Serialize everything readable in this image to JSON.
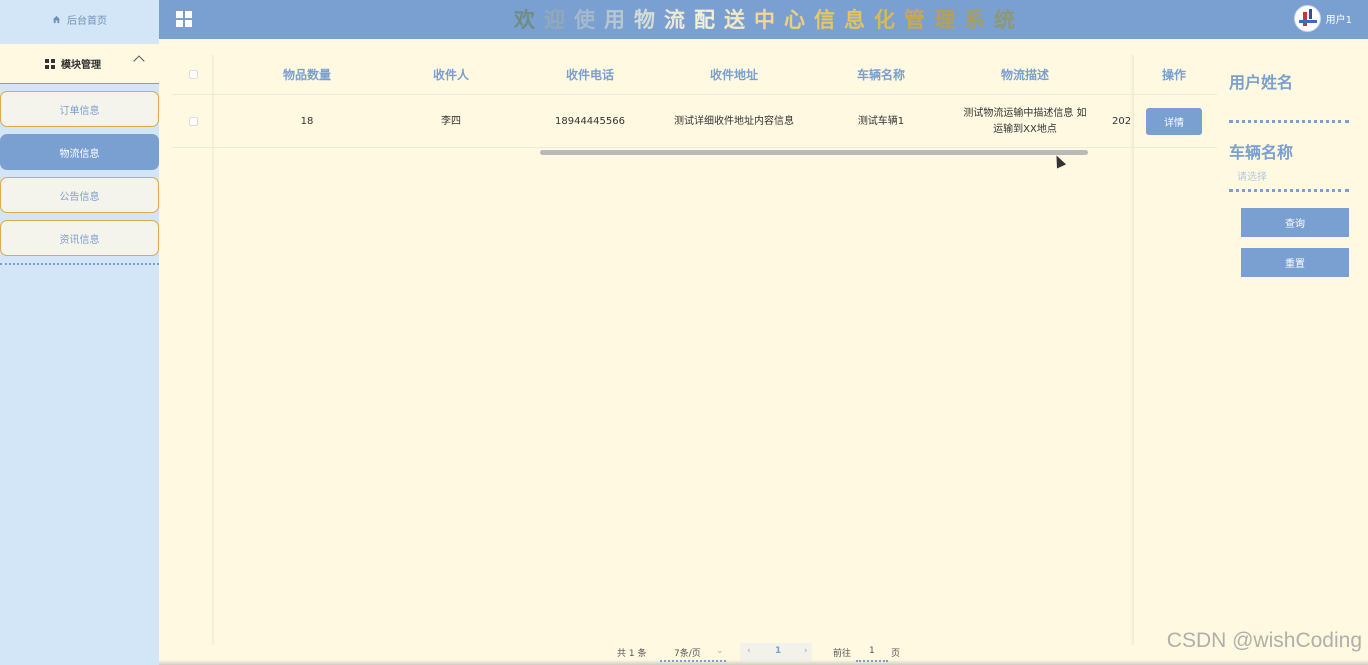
{
  "topbar": {
    "home_label": "后台首页",
    "title_chars": [
      {
        "ch": "欢",
        "color": "#6f8d83"
      },
      {
        "ch": "迎",
        "color": "#93a9b8"
      },
      {
        "ch": "使",
        "color": "#a5b8cc"
      },
      {
        "ch": "用",
        "color": "#b8c6d2"
      },
      {
        "ch": "物",
        "color": "#d6dcd4"
      },
      {
        "ch": "流",
        "color": "#ebeada"
      },
      {
        "ch": "配",
        "color": "#f4f0d6"
      },
      {
        "ch": "送",
        "color": "#f3e8c6"
      },
      {
        "ch": "中",
        "color": "#f3d88e"
      },
      {
        "ch": "心",
        "color": "#efd07a"
      },
      {
        "ch": "信",
        "color": "#e8c860"
      },
      {
        "ch": "息",
        "color": "#e2c45e"
      },
      {
        "ch": "化",
        "color": "#d8b858"
      },
      {
        "ch": "管",
        "color": "#c8a852"
      },
      {
        "ch": "理",
        "color": "#b8a050"
      },
      {
        "ch": "系",
        "color": "#a79e62"
      },
      {
        "ch": "统",
        "color": "#8c9a73"
      }
    ],
    "user_label": "用户1"
  },
  "sidebar": {
    "module_label": "模块管理",
    "items": [
      {
        "label": "订单信息",
        "active": false
      },
      {
        "label": "物流信息",
        "active": true
      },
      {
        "label": "公告信息",
        "active": false
      },
      {
        "label": "资讯信息",
        "active": false
      }
    ]
  },
  "table": {
    "headers": [
      "物品数量",
      "收件人",
      "收件电话",
      "收件地址",
      "车辆名称",
      "物流描述",
      "操作"
    ],
    "rows": [
      {
        "quantity": "18",
        "recipient": "李四",
        "phone": "18944445566",
        "address": "测试详细收件地址内容信息",
        "vehicle": "测试车辆1",
        "desc_line1": "测试物流运输中描述信息 如",
        "desc_line2": "运输到XX地点",
        "truncated": "202",
        "action": "详情"
      }
    ]
  },
  "search": {
    "username_label": "用户姓名",
    "vehicle_label": "车辆名称",
    "vehicle_placeholder": "请选择",
    "query_button": "查询",
    "reset_button": "重置"
  },
  "pager": {
    "total": "共 1 条",
    "page_size": "7条/页",
    "current_page": "1",
    "goto_label": "前往",
    "goto_value": "1",
    "page_unit": "页"
  },
  "watermark": "CSDN @wishCoding"
}
